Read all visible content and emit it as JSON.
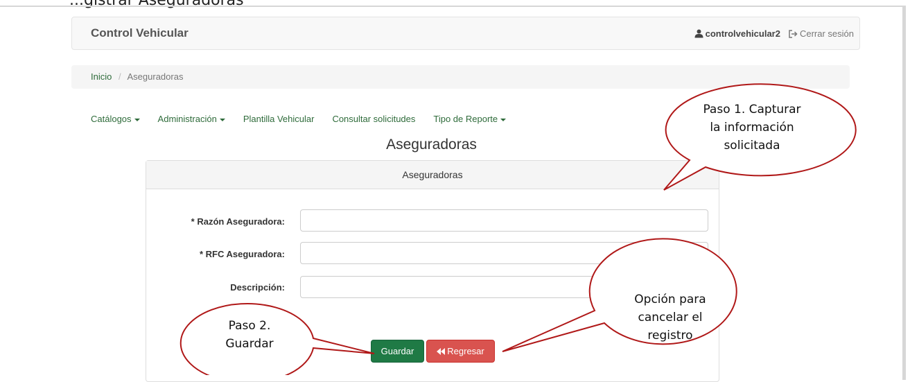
{
  "top_caption": "...gistrar Aseguradoras",
  "navbar": {
    "brand": "Control Vehicular",
    "username": "controlvehicular2",
    "logout": "Cerrar sesión"
  },
  "breadcrumb": {
    "home": "Inicio",
    "separator": "/",
    "current": "Aseguradoras"
  },
  "menu": [
    {
      "label": "Catálogos"
    },
    {
      "label": "Administración"
    },
    {
      "label": "Plantilla Vehicular"
    },
    {
      "label": "Consultar solicitudes"
    },
    {
      "label": "Tipo de Reporte"
    }
  ],
  "page": {
    "title": "Aseguradoras"
  },
  "panel": {
    "heading": "Aseguradoras",
    "fields": [
      {
        "label": "* Razón Aseguradora:",
        "value": ""
      },
      {
        "label": "* RFC Aseguradora:",
        "value": ""
      },
      {
        "label": "Descripción:",
        "value": ""
      }
    ],
    "save_label": "Guardar",
    "back_label": "Regresar"
  },
  "callouts": {
    "step1": [
      "Paso 1. Capturar",
      "la información",
      "solicitada"
    ],
    "step2": [
      "Paso 2.",
      "Guardar"
    ],
    "cancel": [
      "Opción para",
      "cancelar el",
      "registro"
    ]
  },
  "colors": {
    "link_green": "#2e6b3a",
    "save_green": "#1f7a45",
    "back_red": "#d9534f",
    "callout_red": "#b01818"
  },
  "icons": {
    "user": "user-icon",
    "logout": "logout-icon",
    "back": "double-chevron-left-icon"
  }
}
